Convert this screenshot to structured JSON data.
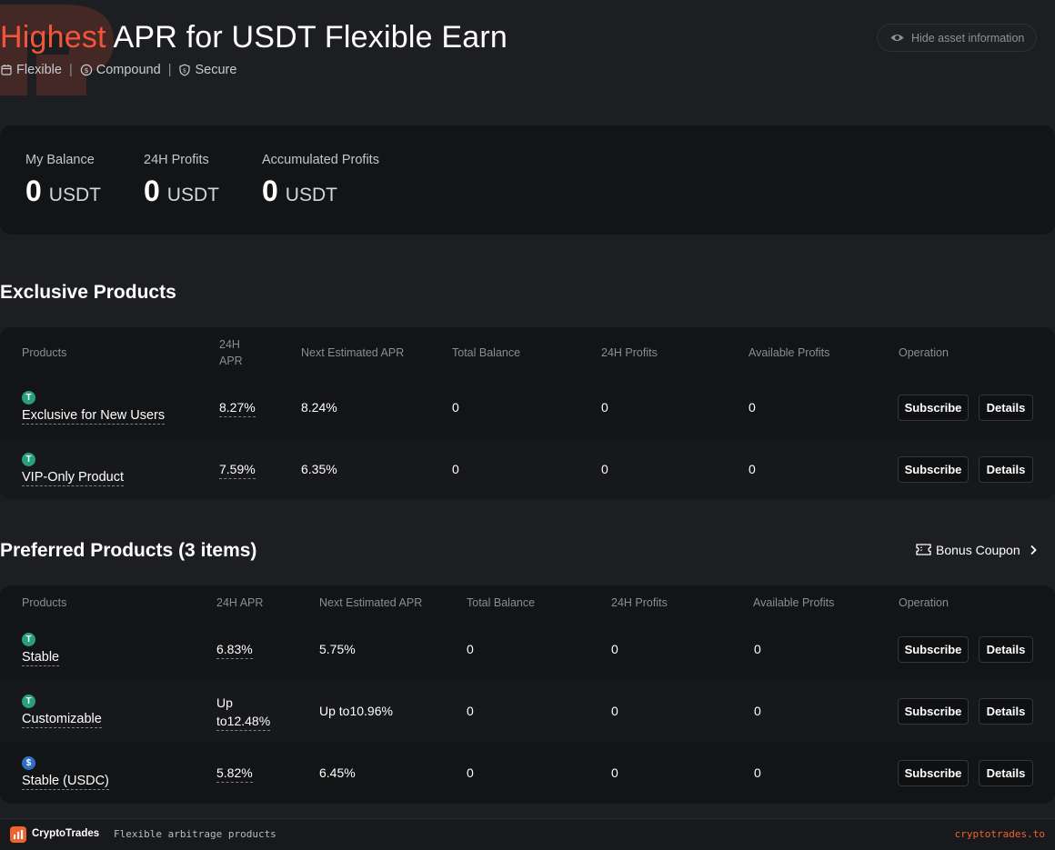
{
  "header": {
    "title_highlight": "Highest",
    "title_rest": " APR for USDT Flexible Earn",
    "tags": [
      "Flexible",
      "Compound",
      "Secure"
    ],
    "hide_button": "Hide asset information"
  },
  "balance": [
    {
      "label": "My Balance",
      "value": "0",
      "unit": "USDT"
    },
    {
      "label": "24H Profits",
      "value": "0",
      "unit": "USDT"
    },
    {
      "label": "Accumulated Profits",
      "value": "0",
      "unit": "USDT"
    }
  ],
  "exclusive": {
    "title": "Exclusive Products",
    "headers": {
      "products": "Products",
      "apr_line1": "24H",
      "apr_line2": "APR",
      "next_apr": "Next Estimated APR",
      "total_balance": "Total Balance",
      "profits_24h": "24H Profits",
      "available_profits": "Available Profits",
      "operation": "Operation"
    },
    "rows": [
      {
        "coin": "usdt",
        "name": "Exclusive for New Users",
        "apr": "8.27%",
        "next_apr": "8.24%",
        "total_balance": "0",
        "profits_24h": "0",
        "available_profits": "0"
      },
      {
        "coin": "usdt",
        "name": "VIP-Only Product",
        "apr": "7.59%",
        "next_apr": "6.35%",
        "total_balance": "0",
        "profits_24h": "0",
        "available_profits": "0"
      }
    ]
  },
  "preferred": {
    "title": "Preferred Products (3 items)",
    "bonus_coupon": "Bonus Coupon",
    "headers": {
      "products": "Products",
      "apr": "24H APR",
      "next_apr": "Next Estimated APR",
      "total_balance": "Total Balance",
      "profits_24h": "24H Profits",
      "available_profits": "Available Profits",
      "operation": "Operation"
    },
    "rows": [
      {
        "coin": "usdt",
        "name": "Stable",
        "apr_line1": "6.83%",
        "apr_line2": "",
        "next_apr": "5.75%",
        "total_balance": "0",
        "profits_24h": "0",
        "available_profits": "0"
      },
      {
        "coin": "usdt",
        "name": "Customizable",
        "apr_line1": "Up",
        "apr_line2": "to12.48%",
        "next_apr": "Up to10.96%",
        "total_balance": "0",
        "profits_24h": "0",
        "available_profits": "0"
      },
      {
        "coin": "usdc",
        "name": "Stable (USDC)",
        "apr_line1": "5.82%",
        "apr_line2": "",
        "next_apr": "6.45%",
        "total_balance": "0",
        "profits_24h": "0",
        "available_profits": "0"
      }
    ]
  },
  "buttons": {
    "subscribe": "Subscribe",
    "details": "Details"
  },
  "footer": {
    "brand": "CryptoTrades",
    "tagline": "Flexible arbitrage products",
    "site": "cryptotrades.to"
  },
  "colors": {
    "accent": "#f2553a",
    "background": "#1d1e21",
    "card": "#131416",
    "usdt": "#26a17b",
    "usdc": "#2f6fbf"
  }
}
